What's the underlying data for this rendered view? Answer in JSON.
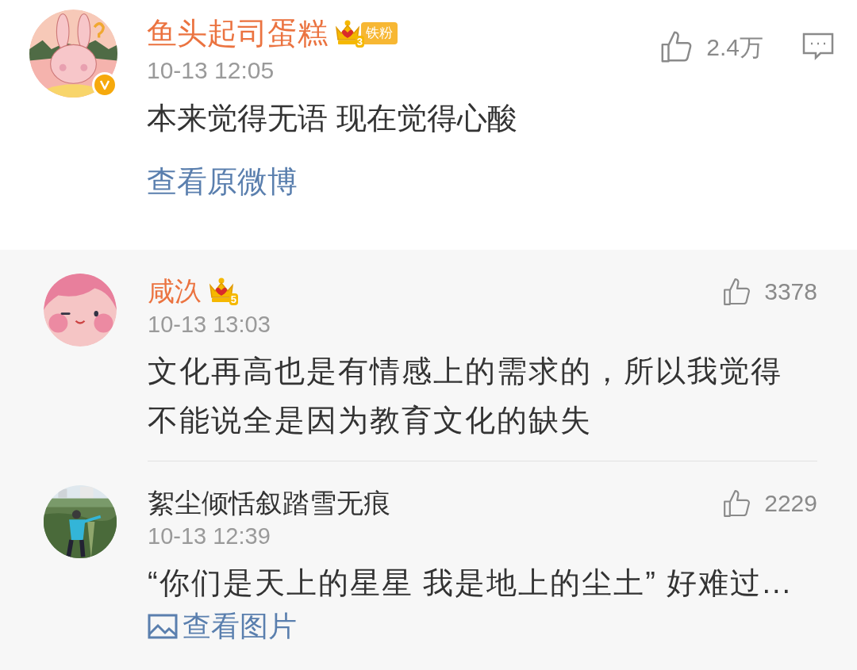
{
  "comment": {
    "author": "鱼头起司蛋糕",
    "author_highlight": true,
    "crown_level": "3",
    "fan_badge": "铁粉",
    "verified": true,
    "avatar": {
      "kind": "bunny"
    },
    "time": "10-13 12:05",
    "likes": "2.4万",
    "text": "本来觉得无语 现在觉得心酸",
    "link": "查看原微博"
  },
  "replies": [
    {
      "author": "咸汣",
      "author_highlight": true,
      "crown_level": "5",
      "avatar": {
        "kind": "girl"
      },
      "time": "10-13 13:03",
      "likes": "3378",
      "text": "文化再高也是有情感上的需求的，所以我觉得不能说全是因为教育文化的缺失"
    },
    {
      "author": "絮尘倾恬叙踏雪无痕",
      "author_highlight": false,
      "time": "10-13 12:39",
      "likes": "2229",
      "text": "“你们是天上的星星 我是地上的尘土” 好难过...",
      "link": "查看图片"
    }
  ]
}
